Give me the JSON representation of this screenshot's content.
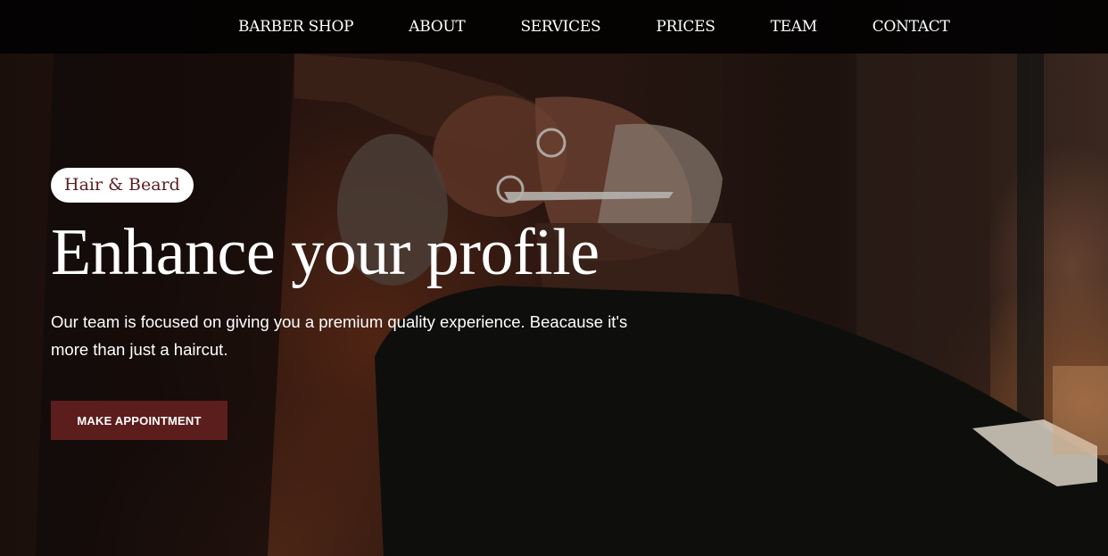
{
  "nav": {
    "items": [
      {
        "label": "BARBER SHOP"
      },
      {
        "label": "ABOUT"
      },
      {
        "label": "SERVICES"
      },
      {
        "label": "PRICES"
      },
      {
        "label": "TEAM"
      },
      {
        "label": "CONTACT"
      }
    ]
  },
  "hero": {
    "badge": "Hair & Beard",
    "headline": "Enhance your profile",
    "tagline": "Our team is focused on giving you a premium quality experience. Beacause it's more than just a haircut.",
    "cta_label": "MAKE APPOINTMENT"
  },
  "colors": {
    "accent": "#5c1d1d",
    "badge_text": "#5a1e1e",
    "nav_background": "#030202",
    "text": "#ffffff"
  }
}
